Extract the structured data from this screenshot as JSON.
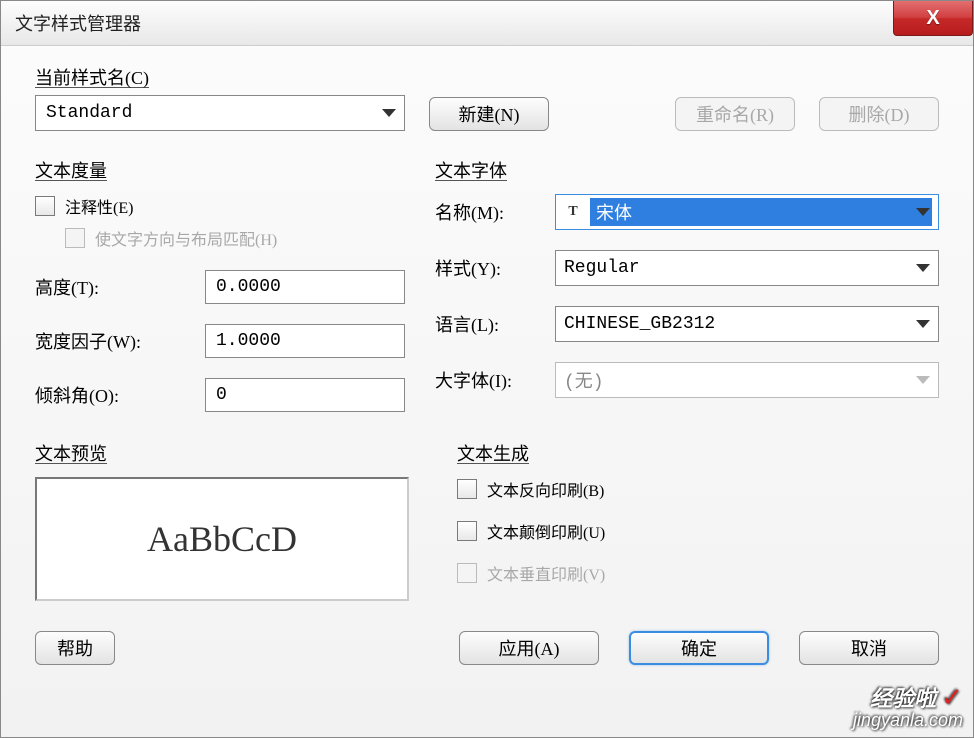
{
  "window": {
    "title": "文字样式管理器",
    "close_glyph": "X"
  },
  "top": {
    "current_style_label": "当前样式名(C)",
    "current_style_value": "Standard",
    "new_btn": "新建(N)",
    "rename_btn": "重命名(R)",
    "delete_btn": "删除(D)"
  },
  "measure": {
    "group": "文本度量",
    "annotative": "注释性(E)",
    "match_orient": "使文字方向与布局匹配(H)",
    "height_label": "高度(T):",
    "height_value": "0.0000",
    "width_label": "宽度因子(W):",
    "width_value": "1.0000",
    "oblique_label": "倾斜角(O):",
    "oblique_value": "0"
  },
  "font": {
    "group": "文本字体",
    "name_label": "名称(M):",
    "name_value": "宋体",
    "tt_icon": "T",
    "style_label": "样式(Y):",
    "style_value": "Regular",
    "lang_label": "语言(L):",
    "lang_value": "CHINESE_GB2312",
    "big_label": "大字体(I):",
    "big_value": "(无)"
  },
  "preview": {
    "group": "文本预览",
    "sample": "AaBbCcD"
  },
  "gen": {
    "group": "文本生成",
    "backwards": "文本反向印刷(B)",
    "upsidedown": "文本颠倒印刷(U)",
    "vertical": "文本垂直印刷(V)"
  },
  "bottom": {
    "help": "帮助",
    "apply": "应用(A)",
    "ok": "确定",
    "cancel": "取消"
  },
  "watermark": {
    "line1": "经验啦",
    "line2": "jingyanla.com",
    "check": "✓"
  }
}
